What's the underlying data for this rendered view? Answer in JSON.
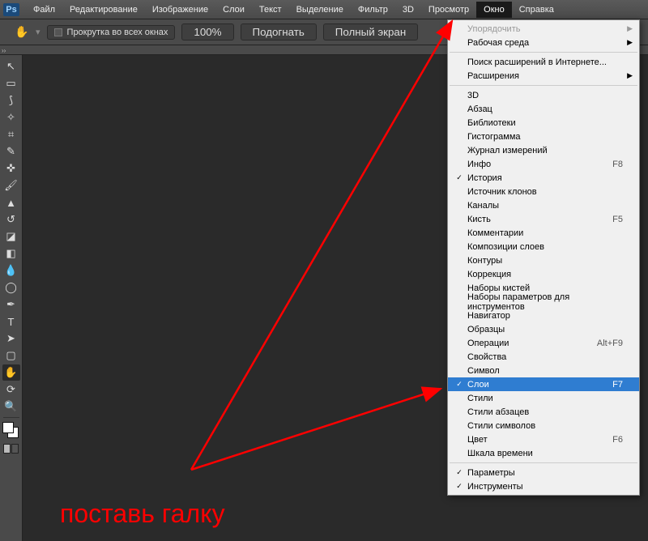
{
  "app_logo": "Ps",
  "menubar": {
    "items": [
      "Файл",
      "Редактирование",
      "Изображение",
      "Слои",
      "Текст",
      "Выделение",
      "Фильтр",
      "3D",
      "Просмотр",
      "Окно",
      "Справка"
    ],
    "active_index": 9
  },
  "optionsbar": {
    "tool_icon": "hand-icon",
    "scroll_all_windows": "Прокрутка во всех окнах",
    "buttons": [
      "100%",
      "Подогнать",
      "Полный экран"
    ]
  },
  "toolbar_tools": [
    {
      "name": "move-tool",
      "glyph": "↖"
    },
    {
      "name": "marquee-tool",
      "glyph": "▭"
    },
    {
      "name": "lasso-tool",
      "glyph": "⟆"
    },
    {
      "name": "magic-wand-tool",
      "glyph": "✧"
    },
    {
      "name": "crop-tool",
      "glyph": "⌗"
    },
    {
      "name": "eyedropper-tool",
      "glyph": "✎"
    },
    {
      "name": "healing-brush-tool",
      "glyph": "✜"
    },
    {
      "name": "brush-tool",
      "glyph": "🖌"
    },
    {
      "name": "stamp-tool",
      "glyph": "▲"
    },
    {
      "name": "history-brush-tool",
      "glyph": "↺"
    },
    {
      "name": "eraser-tool",
      "glyph": "◪"
    },
    {
      "name": "gradient-tool",
      "glyph": "◧"
    },
    {
      "name": "blur-tool",
      "glyph": "💧"
    },
    {
      "name": "dodge-tool",
      "glyph": "◯"
    },
    {
      "name": "pen-tool",
      "glyph": "✒"
    },
    {
      "name": "type-tool",
      "glyph": "T"
    },
    {
      "name": "path-selection-tool",
      "glyph": "➤"
    },
    {
      "name": "shape-tool",
      "glyph": "▢"
    },
    {
      "name": "hand-tool",
      "glyph": "✋",
      "selected": true
    },
    {
      "name": "rotate-view-tool",
      "glyph": "⟳"
    },
    {
      "name": "zoom-tool",
      "glyph": "🔍"
    }
  ],
  "dropdown": {
    "sections": [
      [
        {
          "label": "Упорядочить",
          "submenu": true,
          "disabled": true
        },
        {
          "label": "Рабочая среда",
          "submenu": true
        }
      ],
      [
        {
          "label": "Поиск расширений в Интернете..."
        },
        {
          "label": "Расширения",
          "submenu": true
        }
      ],
      [
        {
          "label": "3D"
        },
        {
          "label": "Абзац"
        },
        {
          "label": "Библиотеки"
        },
        {
          "label": "Гистограмма"
        },
        {
          "label": "Журнал измерений"
        },
        {
          "label": "Инфо",
          "shortcut": "F8"
        },
        {
          "label": "История",
          "checked": true
        },
        {
          "label": "Источник клонов"
        },
        {
          "label": "Каналы"
        },
        {
          "label": "Кисть",
          "shortcut": "F5"
        },
        {
          "label": "Комментарии"
        },
        {
          "label": "Композиции слоев"
        },
        {
          "label": "Контуры"
        },
        {
          "label": "Коррекция"
        },
        {
          "label": "Наборы кистей"
        },
        {
          "label": "Наборы параметров для инструментов"
        },
        {
          "label": "Навигатор"
        },
        {
          "label": "Образцы"
        },
        {
          "label": "Операции",
          "shortcut": "Alt+F9"
        },
        {
          "label": "Свойства"
        },
        {
          "label": "Символ"
        },
        {
          "label": "Слои",
          "shortcut": "F7",
          "checked": true,
          "highlighted": true
        },
        {
          "label": "Стили"
        },
        {
          "label": "Стили абзацев"
        },
        {
          "label": "Стили символов"
        },
        {
          "label": "Цвет",
          "shortcut": "F6"
        },
        {
          "label": "Шкала времени"
        }
      ],
      [
        {
          "label": "Параметры",
          "checked": true
        },
        {
          "label": "Инструменты",
          "checked": true
        }
      ]
    ]
  },
  "annotation_text": "поставь галку"
}
